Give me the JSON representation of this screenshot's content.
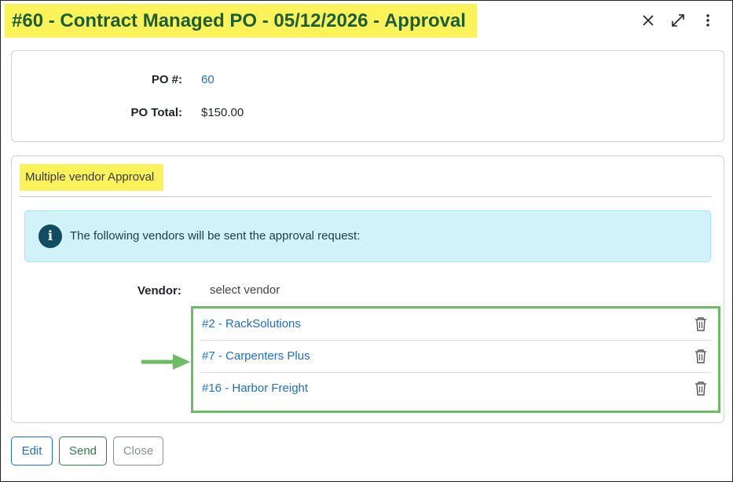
{
  "header": {
    "title": "#60 - Contract Managed PO - 05/12/2026 - Approval",
    "icons": [
      "close-icon",
      "expand-icon",
      "more-vertical-icon"
    ]
  },
  "po_details": {
    "po_number_label": "PO #:",
    "po_number_value": "60",
    "po_total_label": "PO Total:",
    "po_total_value": "$150.00"
  },
  "approval": {
    "section_title": "Multiple vendor Approval",
    "info_text": "The following vendors will be sent the approval request:",
    "vendor_label": "Vendor:",
    "vendor_placeholder": "select vendor",
    "vendors": [
      {
        "name": "#2 - RackSolutions"
      },
      {
        "name": "#7 - Carpenters Plus"
      },
      {
        "name": "#16 - Harbor Freight"
      }
    ]
  },
  "footer": {
    "edit_label": "Edit",
    "send_label": "Send",
    "close_label": "Close"
  },
  "colors": {
    "title_highlight": "#fcf35a",
    "title_text": "#1b5e3a",
    "link": "#1a6fd1",
    "info_bg": "#d2f2fa",
    "vendor_list_border": "#6dbb63"
  }
}
